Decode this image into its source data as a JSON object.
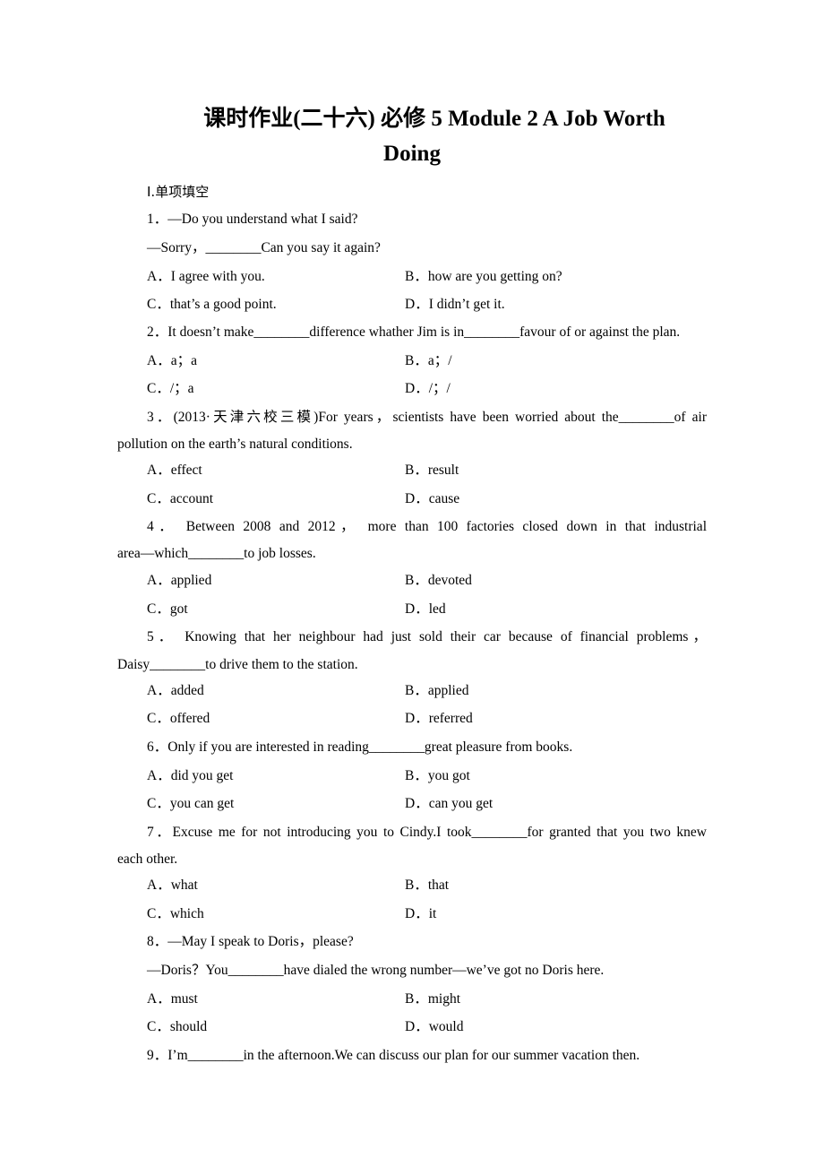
{
  "document": {
    "title_line1": "课时作业(二十六)    必修 5    Module 2    A Job Worth",
    "title_line2": "Doing",
    "section_heading": "Ⅰ.单项填空",
    "questions": [
      {
        "number": "1",
        "stem_lines": [
          "1．—Do you understand what I said?",
          "—Sorry，________Can you say it again?"
        ],
        "options": [
          "A．I agree with you.",
          "B．how are you getting on?",
          "C．that’s a good point.",
          "D．I didn’t get it."
        ]
      },
      {
        "number": "2",
        "stem_lines": [
          "2．It doesn’t make________difference whather Jim is in________favour of or against the plan."
        ],
        "options": [
          "A．a；a",
          "B．a；/",
          "C．/；a",
          "D．/；/"
        ]
      },
      {
        "number": "3",
        "stem_lines": [
          "3．(2013·天津六校三模)For years，scientists have been worried about the________of air",
          "pollution on the earth’s natural conditions."
        ],
        "options": [
          "A．effect",
          "B．result",
          "C．account",
          "D．cause"
        ]
      },
      {
        "number": "4",
        "stem_lines": [
          "4． Between 2008 and 2012， more than 100 factories closed down in that industrial",
          "area—which________to job losses."
        ],
        "options": [
          "A．applied",
          "B．devoted",
          "C．got",
          "D．led"
        ]
      },
      {
        "number": "5",
        "stem_lines": [
          "5． Knowing that her neighbour had just sold their car because of financial problems，",
          "Daisy________to drive them to the station."
        ],
        "options": [
          "A．added",
          "B．applied",
          "C．offered",
          "D．referred"
        ]
      },
      {
        "number": "6",
        "stem_lines": [
          "6．Only if you are interested in reading________great pleasure from books."
        ],
        "options": [
          "A．did you get",
          "B．you got",
          "C．you can get",
          "D．can you get"
        ]
      },
      {
        "number": "7",
        "stem_lines": [
          "7．Excuse me for not introducing you to Cindy.I took________for granted that you two knew",
          "each other."
        ],
        "options": [
          "A．what",
          "B．that",
          "C．which",
          "D．it"
        ]
      },
      {
        "number": "8",
        "stem_lines": [
          "8．—May I speak to Doris，please?",
          "—Doris？You________have dialed the wrong number—we’ve got no Doris here."
        ],
        "options": [
          "A．must",
          "B．might",
          "C．should",
          "D．would"
        ]
      },
      {
        "number": "9",
        "stem_lines": [
          "9．I’m________in the afternoon.We can discuss our plan for our summer vacation then."
        ],
        "options": []
      }
    ]
  }
}
